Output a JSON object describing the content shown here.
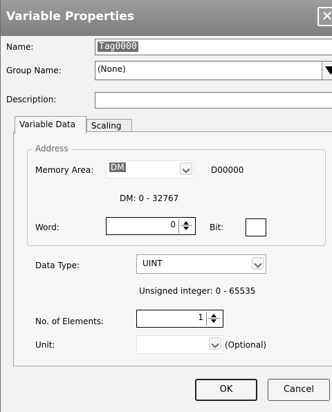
{
  "window": {
    "title": "Variable Properties"
  },
  "fields": {
    "name_label": "Name:",
    "name_value": "Tag0000",
    "group_label": "Group Name:",
    "group_value": "(None)",
    "description_label": "Description:",
    "description_value": ""
  },
  "tabs": [
    {
      "label": "Variable Data",
      "active": true
    },
    {
      "label": "Scaling",
      "active": false
    }
  ],
  "address": {
    "legend": "Address",
    "memory_area_label": "Memory Area:",
    "memory_area_value": "DM",
    "address_value": "D00000",
    "range_text": "DM: 0 - 32767",
    "word_label": "Word:",
    "word_value": "0",
    "bit_label": "Bit:",
    "bit_value": ""
  },
  "data": {
    "type_label": "Data Type:",
    "type_value": "UINT",
    "type_hint": "Unsigned integer: 0 - 65535",
    "elements_label": "No. of Elements:",
    "elements_value": "1",
    "unit_label": "Unit:",
    "unit_value": "",
    "optional_text": "(Optional)"
  },
  "buttons": {
    "ok": "OK",
    "cancel": "Cancel"
  }
}
